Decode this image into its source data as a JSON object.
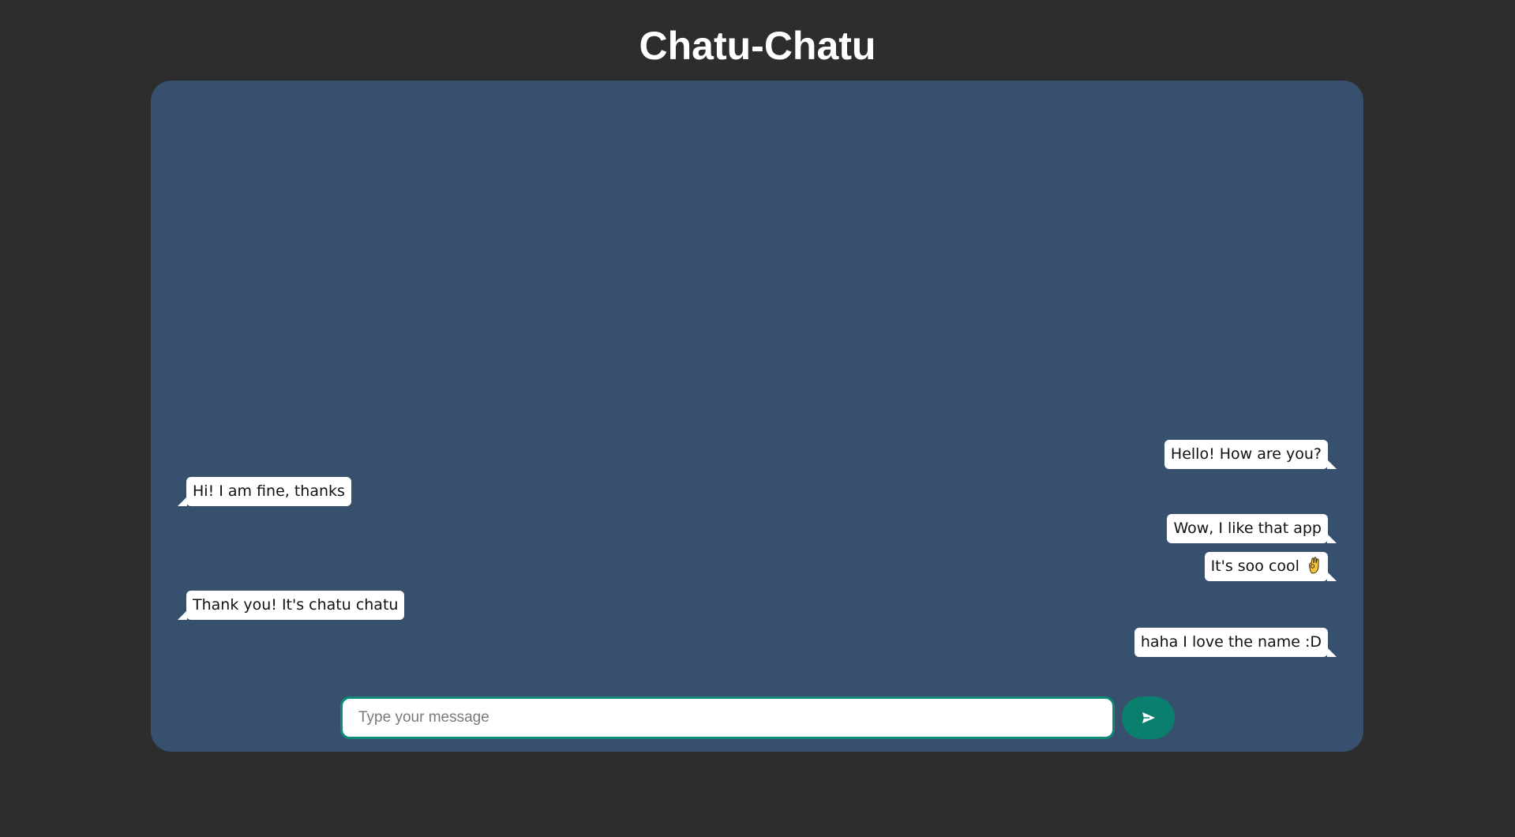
{
  "app": {
    "title": "Chatu-Chatu"
  },
  "messages": [
    {
      "direction": "sent",
      "text": "Hello! How are you?"
    },
    {
      "direction": "received",
      "text": "Hi! I am fine, thanks"
    },
    {
      "direction": "sent",
      "text": "Wow, I like that app"
    },
    {
      "direction": "sent",
      "text": "It's soo cool",
      "emoji": "ok-hand-emoji"
    },
    {
      "direction": "received",
      "text": "Thank you! It's chatu chatu"
    },
    {
      "direction": "sent",
      "text": "haha I love the name :D"
    }
  ],
  "composer": {
    "placeholder": "Type your message",
    "value": "",
    "send_icon": "send-icon"
  },
  "colors": {
    "page_background": "#2d2d2d",
    "chat_background": "#36506e",
    "bubble_background": "#ffffff",
    "accent": "#0b7f6e",
    "input_border": "#0e8a78"
  }
}
